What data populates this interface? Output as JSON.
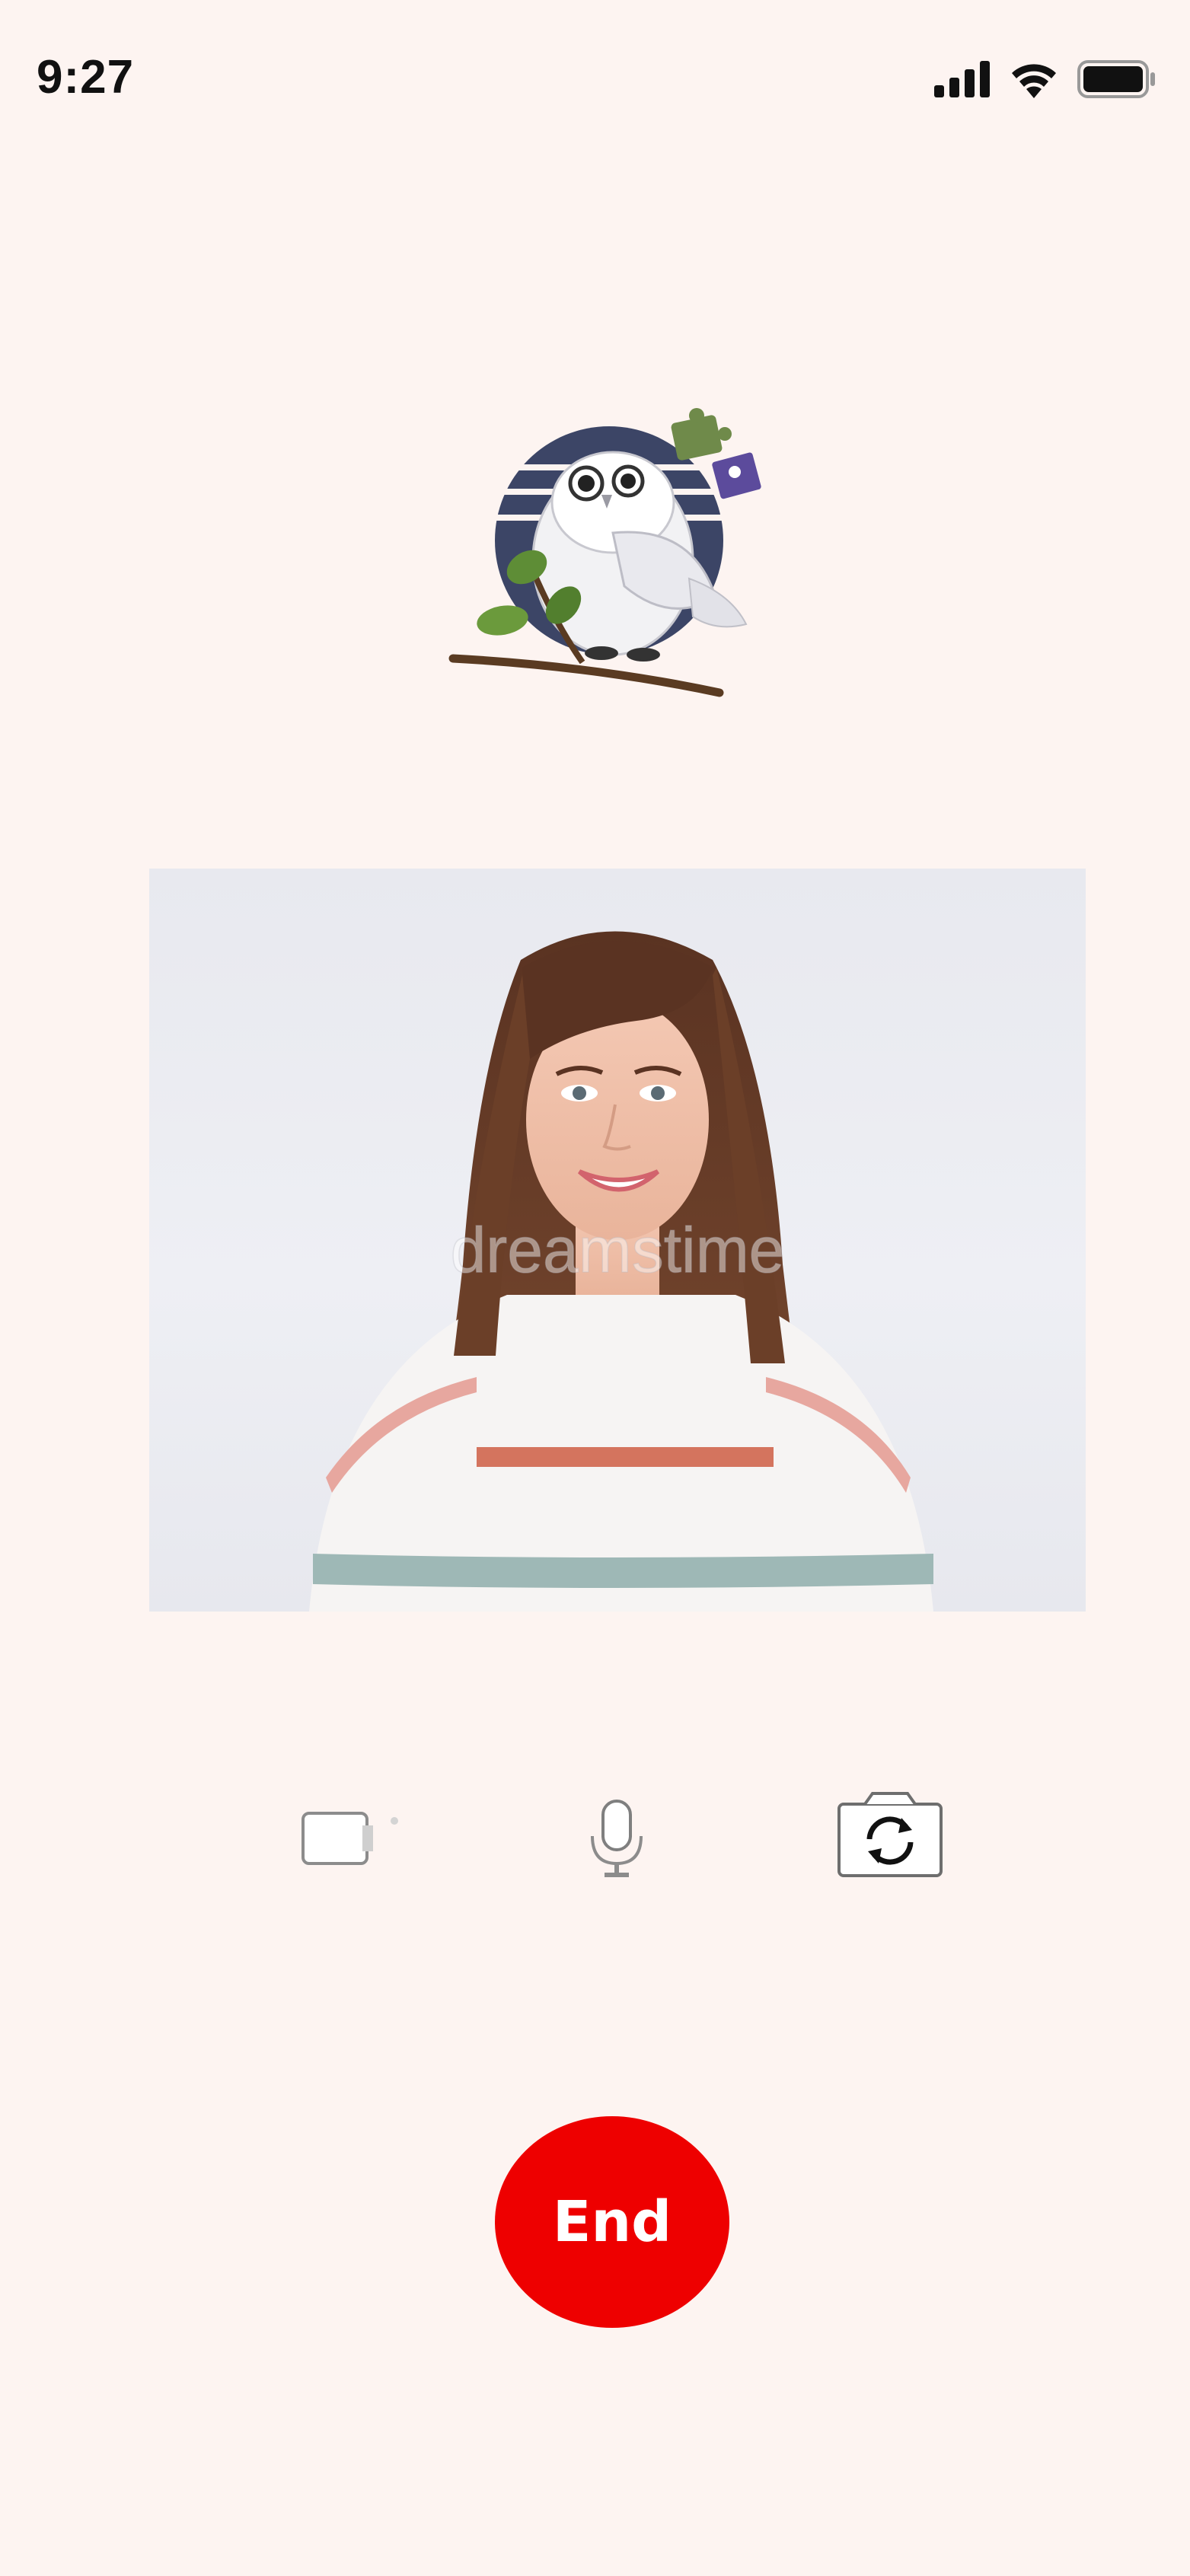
{
  "status_bar": {
    "time": "9:27",
    "icons": [
      "cellular-signal-icon",
      "wifi-icon",
      "battery-icon"
    ]
  },
  "logo": {
    "icon": "owl-puzzle-logo"
  },
  "video_feed": {
    "watermark": "dreamstime",
    "content": "remote-participant-video"
  },
  "controls": {
    "camera": {
      "icon": "video-camera-icon"
    },
    "microphone": {
      "icon": "microphone-icon"
    },
    "flip_camera": {
      "icon": "camera-flip-icon"
    }
  },
  "end_button": {
    "label": "End",
    "color": "#ee0000"
  },
  "colors": {
    "background": "#fdf4f1",
    "end_red": "#ee0000"
  }
}
